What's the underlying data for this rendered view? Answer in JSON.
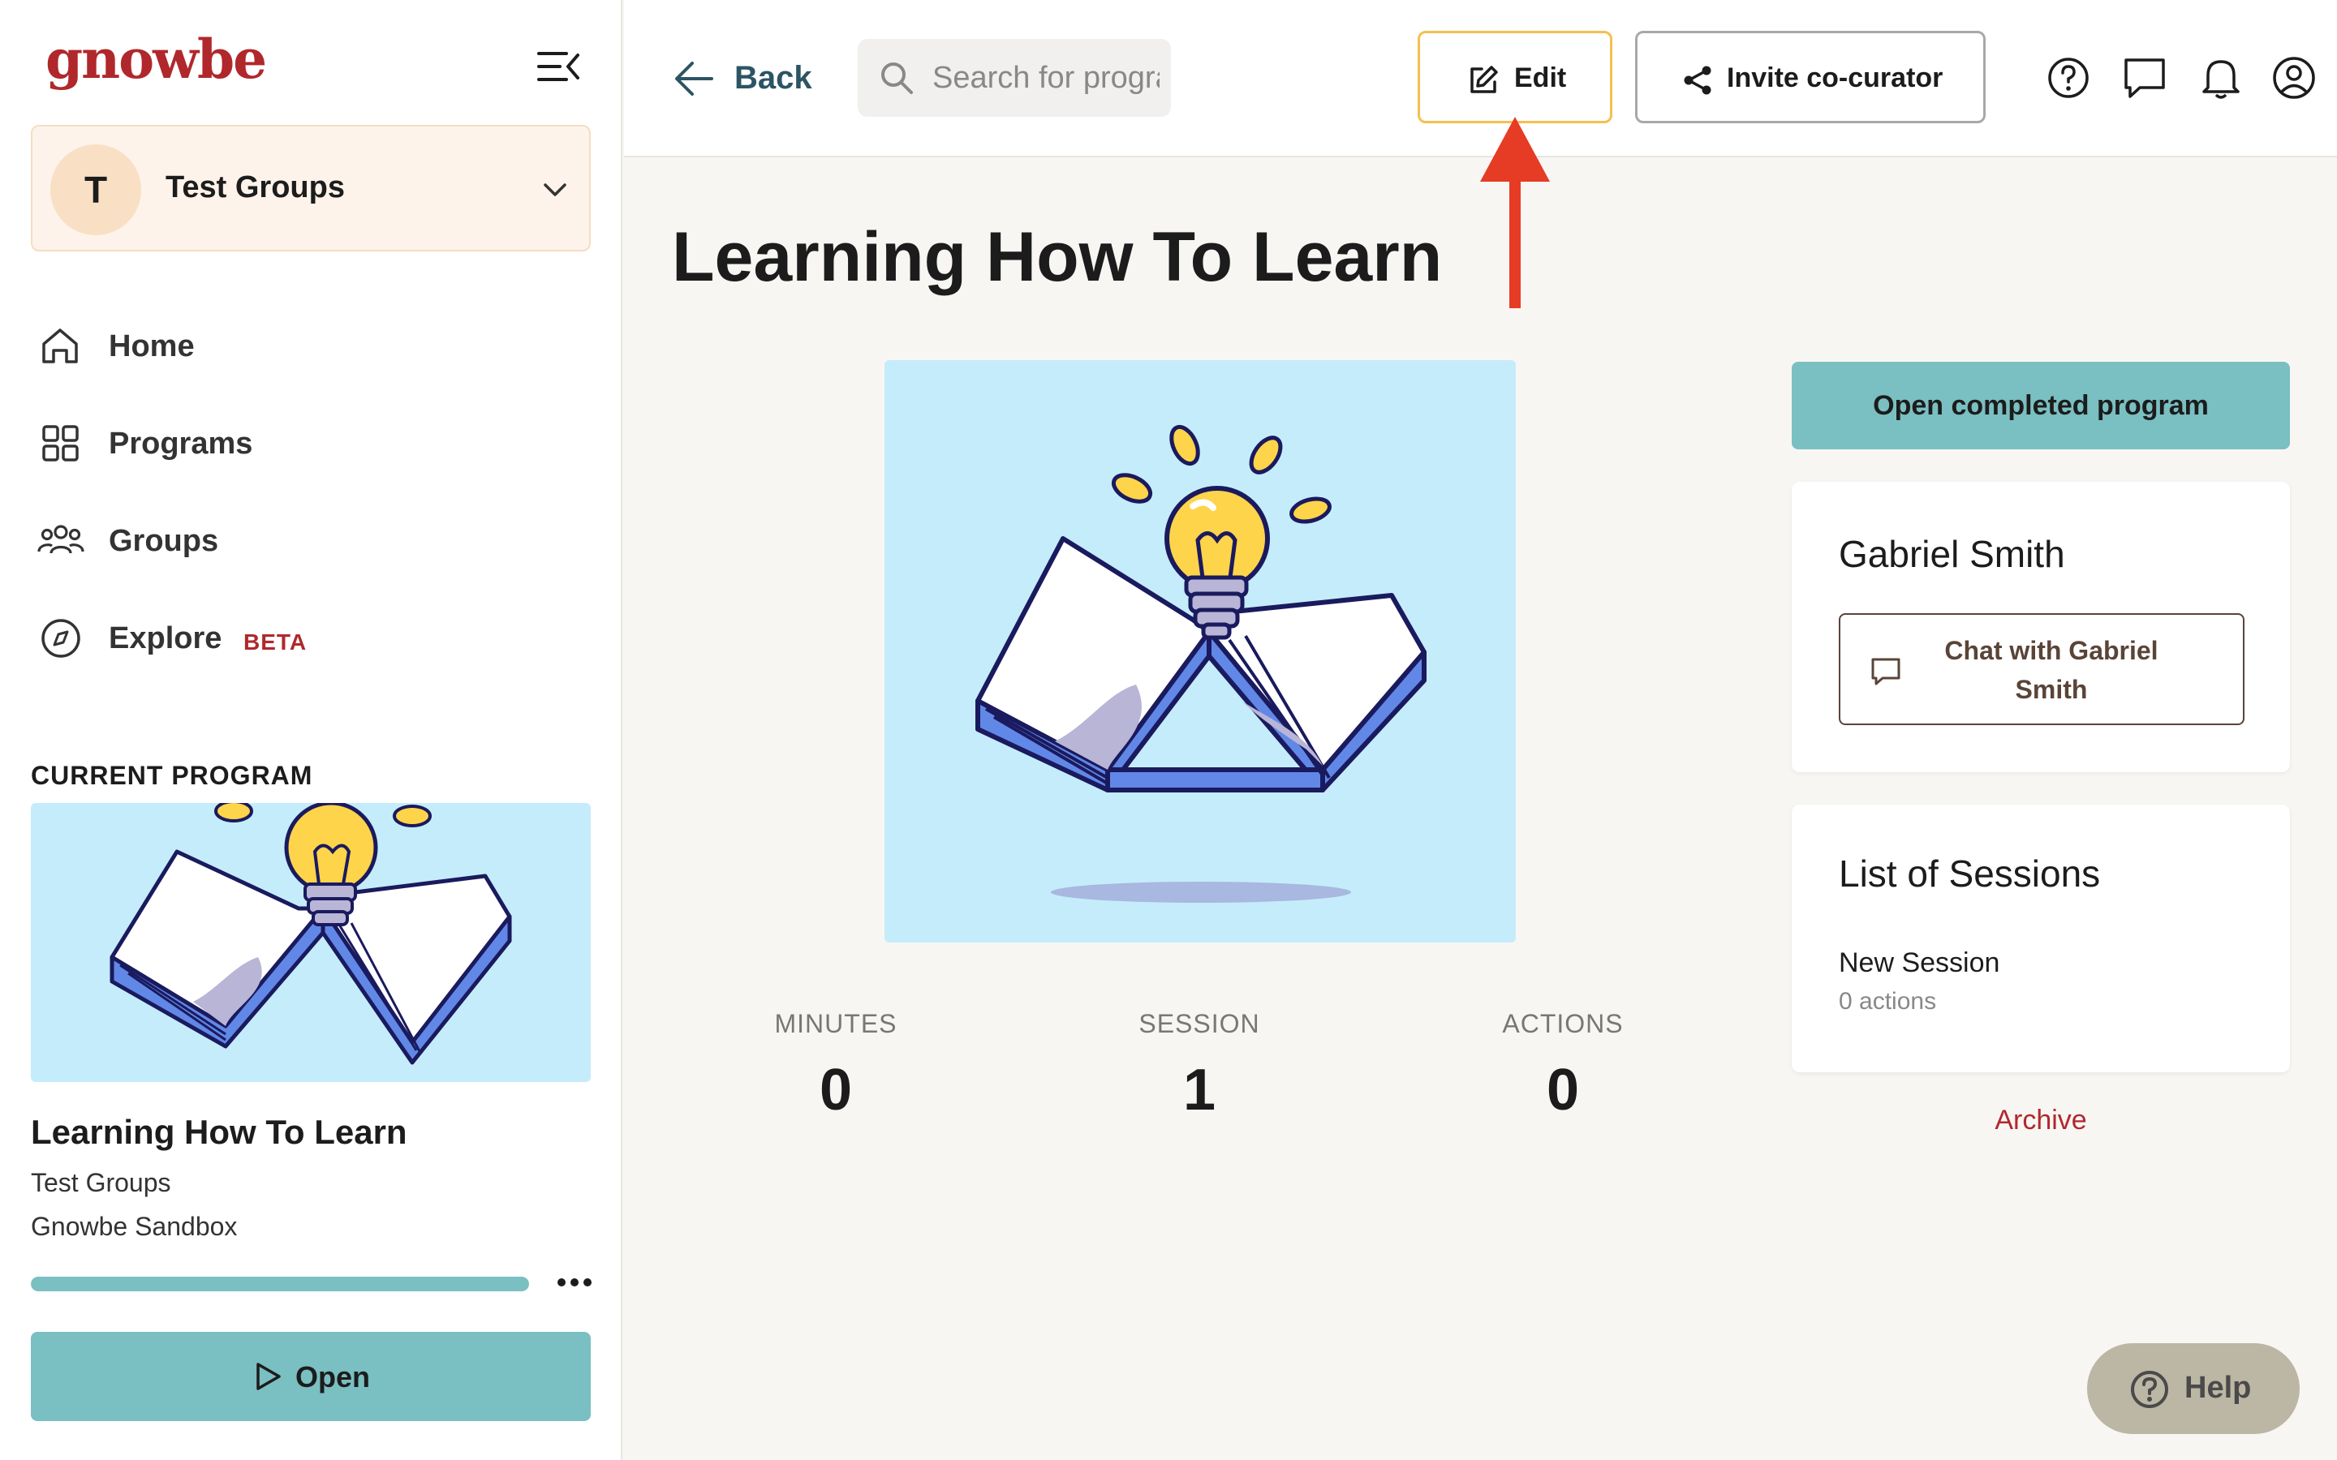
{
  "app": {
    "logo_text": "gnowbe",
    "brand_color": "#b0282c",
    "accent_color": "#7abfc2"
  },
  "org_switcher": {
    "avatar_letter": "T",
    "name": "Test Groups"
  },
  "nav": {
    "items": [
      {
        "label": "Home",
        "icon": "home-icon"
      },
      {
        "label": "Programs",
        "icon": "grid-icon"
      },
      {
        "label": "Groups",
        "icon": "users-icon"
      },
      {
        "label": "Explore",
        "icon": "compass-icon",
        "badge": "BETA"
      }
    ]
  },
  "current_program": {
    "heading": "CURRENT PROGRAM",
    "title": "Learning How To Learn",
    "group": "Test Groups",
    "organization": "Gnowbe Sandbox",
    "progress_fraction": 1.0,
    "open_label": "Open"
  },
  "topbar": {
    "back_label": "Back",
    "search_placeholder": "Search for programs",
    "edit_label": "Edit",
    "invite_label": "Invite co-curator"
  },
  "program": {
    "title": "Learning How To Learn",
    "stats": [
      {
        "label": "MINUTES",
        "value": "0"
      },
      {
        "label": "SESSION",
        "value": "1"
      },
      {
        "label": "ACTIONS",
        "value": "0"
      }
    ],
    "open_completed_label": "Open completed program",
    "curator_name": "Gabriel Smith",
    "chat_label": "Chat with Gabriel Smith",
    "sessions_heading": "List of Sessions",
    "sessions": [
      {
        "name": "New Session",
        "count": "0 actions"
      }
    ],
    "archive_label": "Archive"
  },
  "help": {
    "label": "Help"
  }
}
